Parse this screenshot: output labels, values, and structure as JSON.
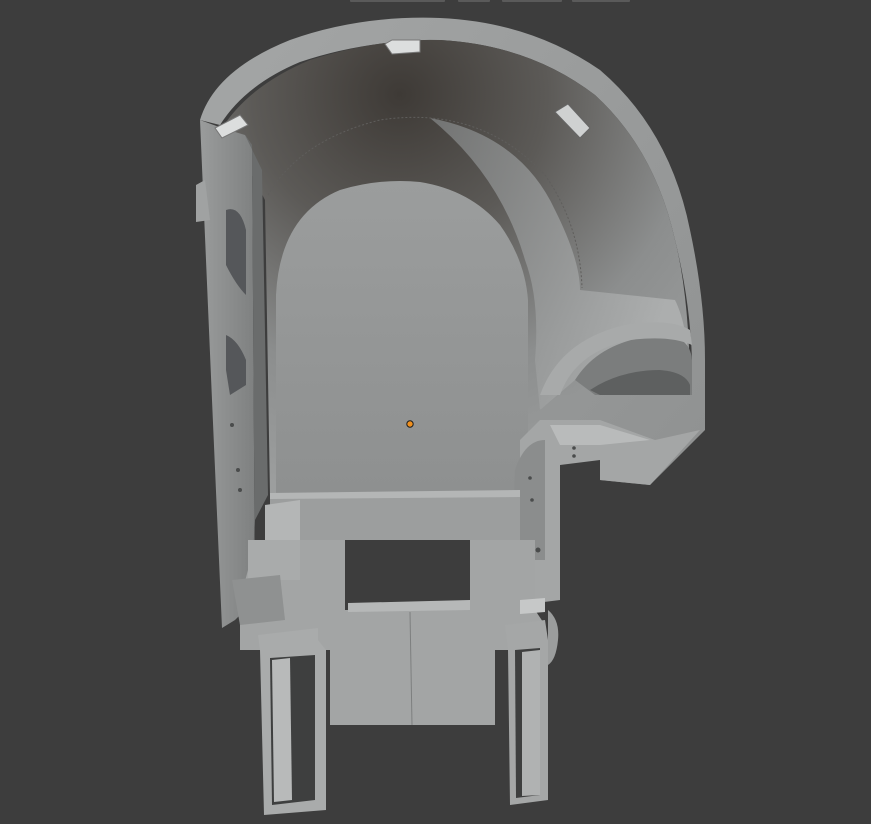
{
  "viewport": {
    "background": "#3d3d3d",
    "mode": "3d-viewport"
  },
  "header": {
    "tabs": [
      {
        "id": "header-tab-1"
      },
      {
        "id": "header-tab-2"
      },
      {
        "id": "header-tab-3"
      },
      {
        "id": "header-tab-4"
      }
    ]
  },
  "model": {
    "object_kind": "3d-mesh",
    "surface_colors": {
      "light": "#a6a8a8",
      "mid": "#8f9191",
      "dark": "#6f7171",
      "shadow": "#4a4846",
      "inner": "#9a9c9c"
    },
    "origin_color": "#f0901e"
  }
}
